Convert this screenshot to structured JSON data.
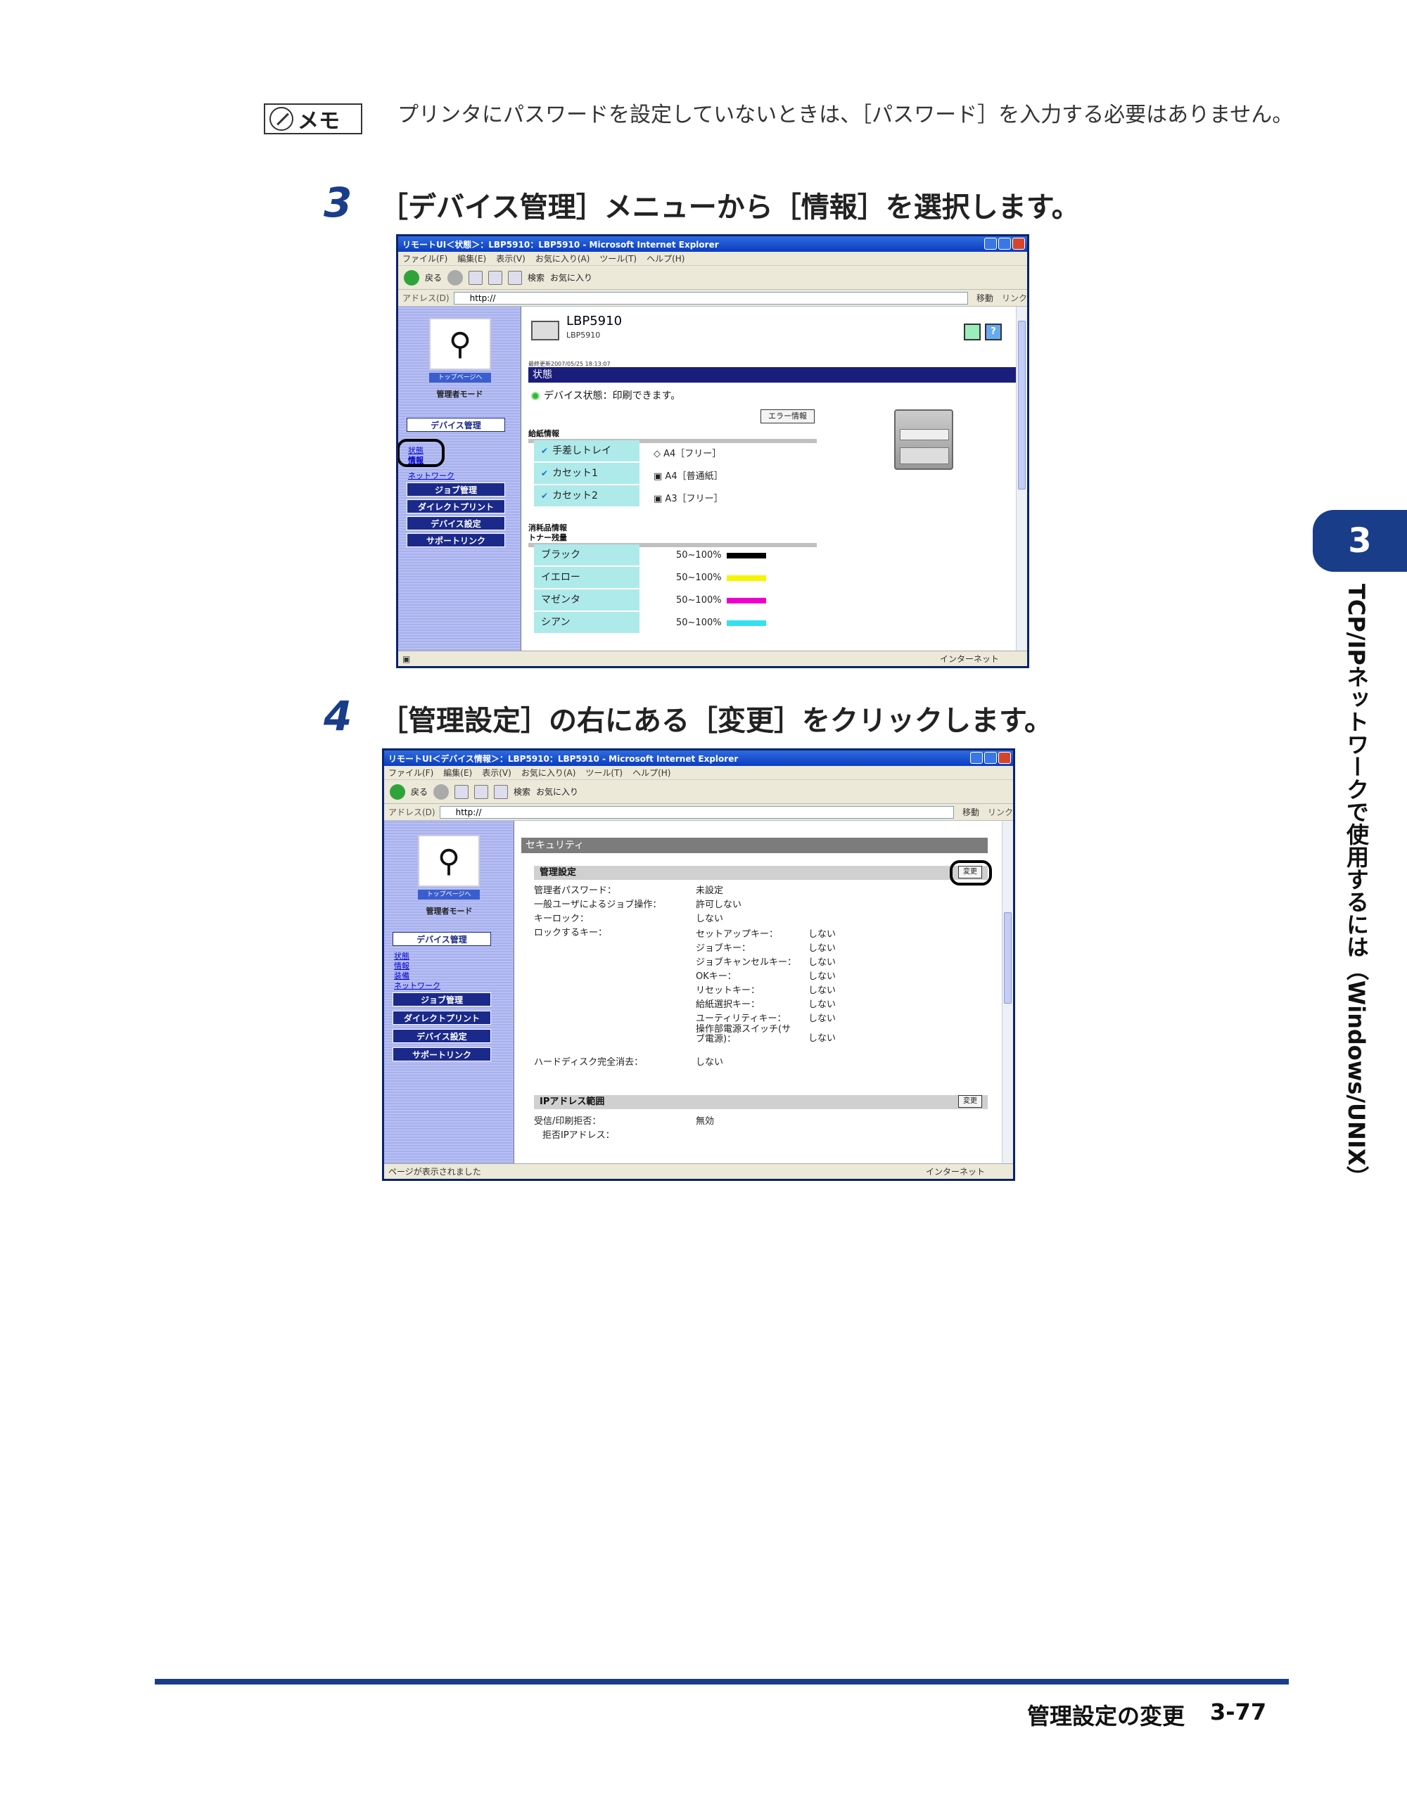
{
  "memo": {
    "label": "メモ",
    "text": "プリンタにパスワードを設定していないときは、［パスワード］を入力する必要はありません。"
  },
  "steps": [
    {
      "num": "3",
      "text": "［デバイス管理］メニューから［情報］を選択します。"
    },
    {
      "num": "4",
      "text": "［管理設定］の右にある［変更］をクリックします。"
    }
  ],
  "browser1": {
    "title": "リモートUI＜状態＞：LBP5910：LBP5910 - Microsoft Internet Explorer",
    "menu": [
      "ファイル(F)",
      "編集(E)",
      "表示(V)",
      "お気に入り(A)",
      "ツール(T)",
      "ヘルプ(H)"
    ],
    "toolbar": {
      "back": "戻る",
      "search": "検索",
      "favorites": "お気に入り"
    },
    "address_label": "アドレス(D)",
    "address": "http://",
    "go": "移動",
    "links": "リンク",
    "nav": {
      "toppage": "トップページへ",
      "mode": "管理者モード",
      "device_mgmt": "デバイス管理",
      "links": [
        "状態",
        "情報",
        "ネットワーク"
      ],
      "job_mgmt": "ジョブ管理",
      "direct_print": "ダイレクトプリント",
      "device_settings": "デバイス設定",
      "support_link": "サポートリンク"
    },
    "device_name": "LBP5910",
    "device_sub": "LBP5910",
    "updated": "最終更新2007/05/25 18:13:07",
    "status_bar": "状態",
    "device_status_label": "デバイス状態：",
    "device_status_value": "印刷できます。",
    "error_info_btn": "エラー情報",
    "paper_head": "給紙情報",
    "paper_rows": [
      {
        "name": "手差しトレイ",
        "value": "A4［フリー］"
      },
      {
        "name": "カセット1",
        "value": "A4［普通紙］"
      },
      {
        "name": "カセット2",
        "value": "A3［フリー］"
      }
    ],
    "consumables_head": "消耗品情報",
    "toner_head": "トナー残量",
    "toner_rows": [
      {
        "name": "ブラック",
        "value": "50~100%",
        "color": "#000000"
      },
      {
        "name": "イエロー",
        "value": "50~100%",
        "color": "#f5f500"
      },
      {
        "name": "マゼンタ",
        "value": "50~100%",
        "color": "#ee00cc"
      },
      {
        "name": "シアン",
        "value": "50~100%",
        "color": "#33e0f0"
      }
    ],
    "status_right": "インターネット"
  },
  "browser2": {
    "title": "リモートUI＜デバイス情報＞：LBP5910：LBP5910 - Microsoft Internet Explorer",
    "address": "http://",
    "nav_links": [
      "状態",
      "情報",
      "装備",
      "ネットワーク"
    ],
    "security": "セキュリティ",
    "admin_settings": "管理設定",
    "change_btn": "変更",
    "rows": [
      {
        "key": "管理者パスワード：",
        "value": "未設定"
      },
      {
        "key": "一般ユーザによるジョブ操作：",
        "value": "許可しない"
      },
      {
        "key": "キーロック：",
        "value": "しない"
      },
      {
        "key": "ロックするキー：",
        "value": ""
      }
    ],
    "lock_keys": [
      {
        "key": "セットアップキー：",
        "value": "しない"
      },
      {
        "key": "ジョブキー：",
        "value": "しない"
      },
      {
        "key": "ジョブキャンセルキー：",
        "value": "しない"
      },
      {
        "key": "OKキー：",
        "value": "しない"
      },
      {
        "key": "リセットキー：",
        "value": "しない"
      },
      {
        "key": "給紙選択キー：",
        "value": "しない"
      },
      {
        "key": "ユーティリティキー：",
        "value": "しない"
      },
      {
        "key": "操作部電源スイッチ(サブ電源)：",
        "value": "しない"
      }
    ],
    "hdd_erase_key": "ハードディスク完全消去：",
    "hdd_erase_value": "しない",
    "ip_range": "IPアドレス範囲",
    "receive_reject_key": "受信/印刷拒否：",
    "receive_reject_value": "無効",
    "reject_ip_key": "拒否IPアドレス：",
    "status_left": "ページが表示されました",
    "status_right": "インターネット"
  },
  "side": {
    "chapter": "3",
    "title": "TCP/IPネットワークで使用するには（Windows/UNIX）"
  },
  "footer": {
    "title": "管理設定の変更",
    "page": "3-77"
  }
}
